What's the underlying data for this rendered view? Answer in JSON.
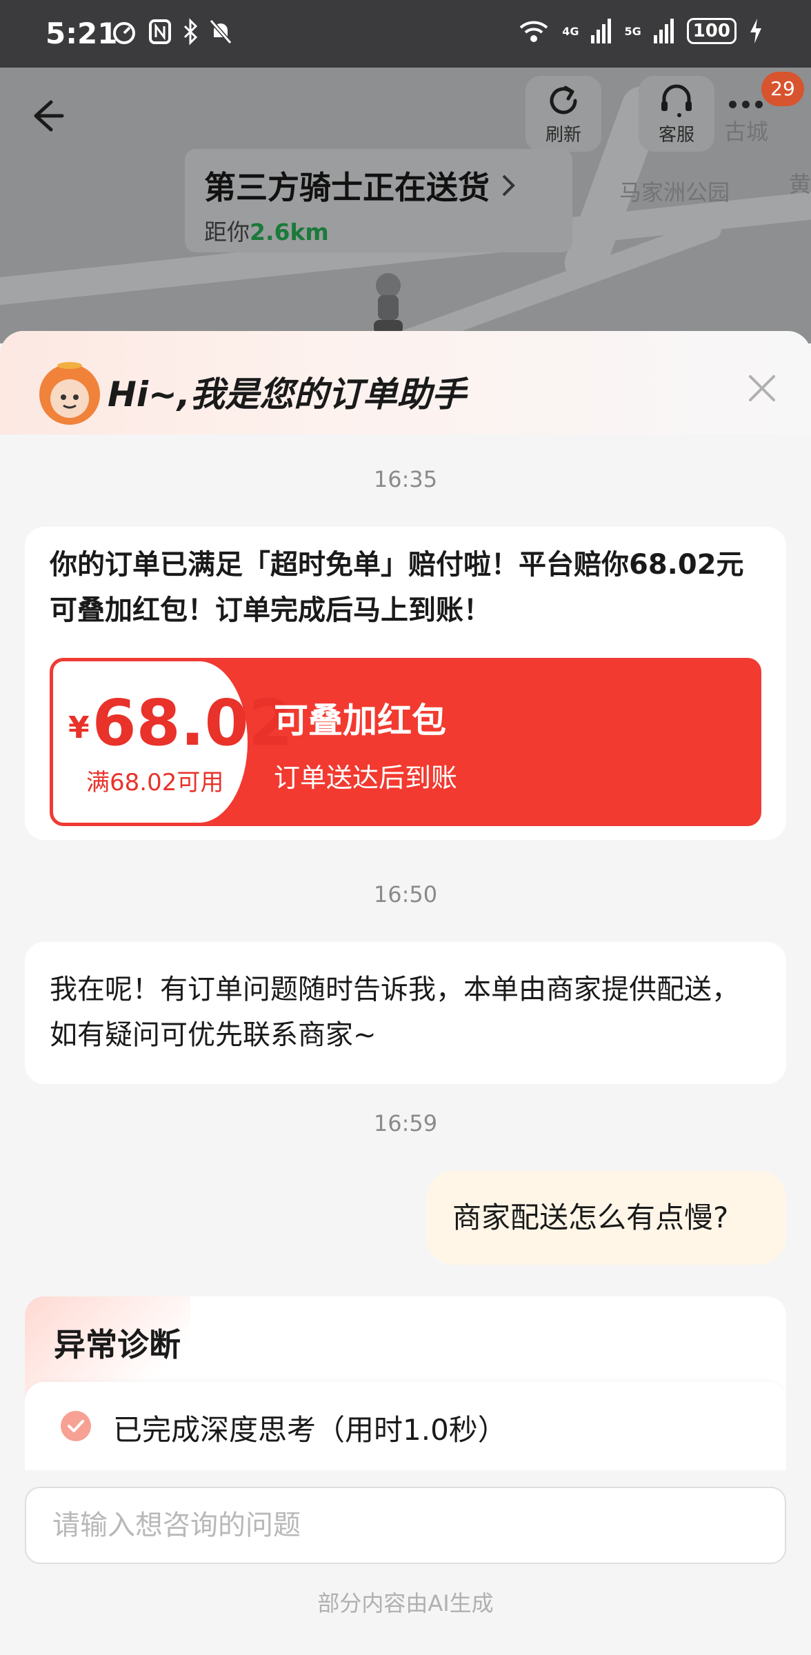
{
  "status_bar": {
    "time": "5:21",
    "signal_4g": "4G",
    "signal_5g": "5G",
    "battery": "100"
  },
  "map": {
    "refresh_label": "刷新",
    "service_label": "客服",
    "notification_count": "29",
    "place_label_1": "马家洲公园",
    "place_label_2": "古城",
    "place_label_3": "黄",
    "rider_status": "第三方骑士正在送货",
    "distance_prefix": "距你",
    "distance_value": "2.6km"
  },
  "assistant": {
    "greeting": "Hi~,我是您的订单助手"
  },
  "messages": [
    {
      "time": "16:35",
      "text": "你的订单已满足「超时免单」赔付啦！平台赔你68.02元可叠加红包！订单完成后马上到账！",
      "coupon": {
        "currency": "¥",
        "amount": "68.02",
        "condition": "满68.02可用",
        "title": "可叠加红包",
        "subtitle": "订单送达后到账"
      }
    },
    {
      "time": "16:50",
      "text": "我在呢！有订单问题随时告诉我，本单由商家提供配送，如有疑问可优先联系商家~"
    },
    {
      "time": "16:59",
      "user_text": "商家配送怎么有点慢?"
    }
  ],
  "diagnosis": {
    "title": "异常诊断",
    "status": "已完成深度思考（用时1.0秒）"
  },
  "input": {
    "placeholder": "请输入想咨询的问题"
  },
  "footer_note": "部分内容由AI生成",
  "colors": {
    "accent_red": "#f23a30",
    "distance_green": "#1a7a3a",
    "badge_orange": "#d8542e"
  }
}
